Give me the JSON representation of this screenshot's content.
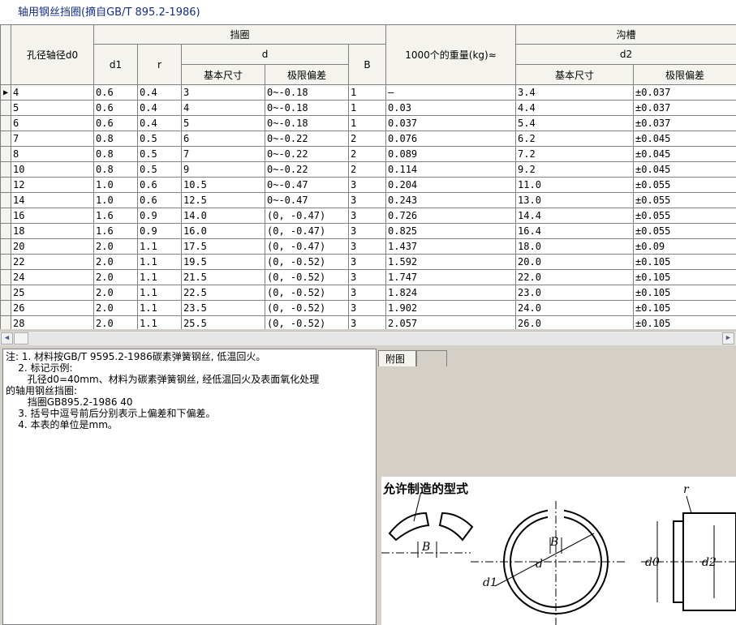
{
  "title": "轴用钢丝挡圈(摘自GB/T 895.2-1986)",
  "headers": {
    "col0": "孔径轴径d0",
    "group_ring": "挡圈",
    "d1": "d1",
    "r": "r",
    "d": "d",
    "d_basic": "基本尺寸",
    "d_tol": "极限偏差",
    "B": "B",
    "weight": "1000个的重量(kg)≈",
    "group_groove": "沟槽",
    "d2": "d2",
    "d2_basic": "基本尺寸",
    "d2_tol": "极限偏差"
  },
  "row_indicator": "▶",
  "rows": [
    [
      "4",
      "0.6",
      "0.4",
      "3",
      "0~-0.18",
      "1",
      "—",
      "3.4",
      "±0.037"
    ],
    [
      "5",
      "0.6",
      "0.4",
      "4",
      "0~-0.18",
      "1",
      "0.03",
      "4.4",
      "±0.037"
    ],
    [
      "6",
      "0.6",
      "0.4",
      "5",
      "0~-0.18",
      "1",
      "0.037",
      "5.4",
      "±0.037"
    ],
    [
      "7",
      "0.8",
      "0.5",
      "6",
      "0~-0.22",
      "2",
      "0.076",
      "6.2",
      "±0.045"
    ],
    [
      "8",
      "0.8",
      "0.5",
      "7",
      "0~-0.22",
      "2",
      "0.089",
      "7.2",
      "±0.045"
    ],
    [
      "10",
      "0.8",
      "0.5",
      "9",
      "0~-0.22",
      "2",
      "0.114",
      "9.2",
      "±0.045"
    ],
    [
      "12",
      "1.0",
      "0.6",
      "10.5",
      "0~-0.47",
      "3",
      "0.204",
      "11.0",
      "±0.055"
    ],
    [
      "14",
      "1.0",
      "0.6",
      "12.5",
      "0~-0.47",
      "3",
      "0.243",
      "13.0",
      "±0.055"
    ],
    [
      "16",
      "1.6",
      "0.9",
      "14.0",
      "(0, -0.47)",
      "3",
      "0.726",
      "14.4",
      "±0.055"
    ],
    [
      "18",
      "1.6",
      "0.9",
      "16.0",
      "(0, -0.47)",
      "3",
      "0.825",
      "16.4",
      "±0.055"
    ],
    [
      "20",
      "2.0",
      "1.1",
      "17.5",
      "(0, -0.47)",
      "3",
      "1.437",
      "18.0",
      "±0.09"
    ],
    [
      "22",
      "2.0",
      "1.1",
      "19.5",
      "(0, -0.52)",
      "3",
      "1.592",
      "20.0",
      "±0.105"
    ],
    [
      "24",
      "2.0",
      "1.1",
      "21.5",
      "(0, -0.52)",
      "3",
      "1.747",
      "22.0",
      "±0.105"
    ],
    [
      "25",
      "2.0",
      "1.1",
      "22.5",
      "(0, -0.52)",
      "3",
      "1.824",
      "23.0",
      "±0.105"
    ],
    [
      "26",
      "2.0",
      "1.1",
      "23.5",
      "(0, -0.52)",
      "3",
      "1.902",
      "24.0",
      "±0.105"
    ],
    [
      "28",
      "2.0",
      "1.1",
      "25.5",
      "(0, -0.52)",
      "3",
      "2.057",
      "26.0",
      "±0.105"
    ]
  ],
  "notes": [
    "注: 1. 材料按GB/T 9595.2-1986碳素弹簧钢丝, 低温回火。",
    "    2. 标记示例:",
    "       孔径d0=40mm、材料为碳素弹簧钢丝, 经低温回火及表面氧化处理",
    "的轴用钢丝挡圈:",
    "       挡圈GB895.2-1986 40",
    "    3. 括号中逗号前后分别表示上偏差和下偏差。",
    "    4. 本表的单位是mm。"
  ],
  "tabs": [
    "附图",
    ""
  ],
  "figure": {
    "caption": "允许制造的型式",
    "labels": {
      "B": "B",
      "d": "d",
      "d1": "d1",
      "d0": "d0",
      "d2": "d2",
      "r": "r"
    }
  },
  "icons": {
    "row_indicator": "triangle-right-icon",
    "scroll_left": "chevron-left-icon",
    "scroll_right": "chevron-right-icon"
  }
}
